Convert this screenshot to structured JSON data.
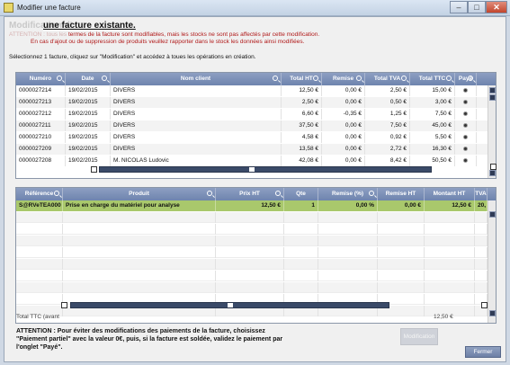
{
  "window": {
    "title": "Modifier une facture"
  },
  "heading": {
    "ghost": "Modification d'",
    "main": "une facture existante."
  },
  "warnings": {
    "line1_dim": "ATTENTION : tous les",
    "line1": " termes de la facture sont modifiables, mais les stocks ne sont pas affectés par cette modification.",
    "line2": "En cas d'ajout ou de suppression de produits veuillez rapporter dans le stock les données ainsi modifiées."
  },
  "instructions": "Sélectionnez 1 facture, cliquez sur \"Modification\" et accédez à toues les opérations en création.",
  "invoices": {
    "headers": [
      "Numéro",
      "Date",
      "Nom client",
      "Total HT",
      "Remise",
      "Total TVA",
      "Total TTC",
      "Payé"
    ],
    "rows": [
      [
        "0000027214",
        "19/02/2015",
        "DIVERS",
        "12,50 €",
        "0,00 €",
        "2,50 €",
        "15,00 €"
      ],
      [
        "0000027213",
        "19/02/2015",
        "DIVERS",
        "2,50 €",
        "0,00 €",
        "0,50 €",
        "3,00 €"
      ],
      [
        "0000027212",
        "19/02/2015",
        "DIVERS",
        "6,60 €",
        "-0,35 €",
        "1,25 €",
        "7,50 €"
      ],
      [
        "0000027211",
        "19/02/2015",
        "DIVERS",
        "37,50 €",
        "0,00 €",
        "7,50 €",
        "45,00 €"
      ],
      [
        "0000027210",
        "19/02/2015",
        "DIVERS",
        "4,58 €",
        "0,00 €",
        "0,92 €",
        "5,50 €"
      ],
      [
        "0000027209",
        "19/02/2015",
        "DIVERS",
        "13,58 €",
        "0,00 €",
        "2,72 €",
        "16,30 €"
      ],
      [
        "0000027208",
        "19/02/2015",
        "M. NICOLAS Ludovic",
        "42,08 €",
        "0,00 €",
        "8,42 €",
        "50,50 €"
      ]
    ]
  },
  "lines": {
    "headers": [
      "Référence",
      "Produit",
      "Prix HT",
      "Qte",
      "Remise (%)",
      "Remise HT",
      "Montant HT",
      "TVA"
    ],
    "rows": [
      [
        "S@RVeTEA000",
        "Prise en charge du matériel pour analyse",
        "12,50 €",
        "1",
        "0,00 %",
        "0,00 €",
        "12,50 €",
        "20,"
      ]
    ]
  },
  "total": {
    "label": "Total TTC (avant",
    "value": "12,50 €"
  },
  "bottom_warning": "ATTENTION : Pour éviter des modifications des paiements de la facture, choisissez \"Paiement partiel\" avec la valeur 0€, puis, si la facture est soldée, validez le paiement par l'onglet \"Payé\".",
  "buttons": {
    "modification": "Modification",
    "fermer": "Fermer"
  }
}
